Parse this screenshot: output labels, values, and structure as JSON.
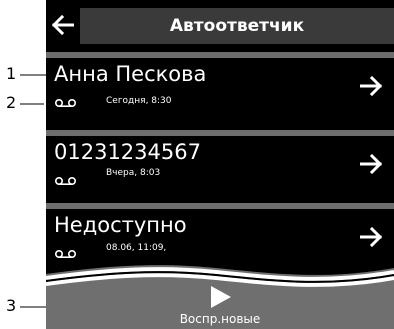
{
  "header": {
    "title": "Автоответчик",
    "back_icon": "arrow-left-icon"
  },
  "messages": [
    {
      "name": "Анна Пескова",
      "time": "Сегодня, 8:30"
    },
    {
      "name": "01231234567",
      "time": "Вчера, 8:03"
    },
    {
      "name": "Недоступно",
      "time": "08.06, 11:09,"
    }
  ],
  "play_new": {
    "label": "Воспр.новые",
    "icon": "play-icon"
  },
  "callouts": {
    "c1": "1",
    "c2": "2",
    "c3": "3"
  },
  "colors": {
    "screen_bg": "#000000",
    "title_bg": "#3a3a3a",
    "separator": "#6d6d6d",
    "bottom_bar": "#6f6f6f",
    "text": "#ffffff"
  }
}
